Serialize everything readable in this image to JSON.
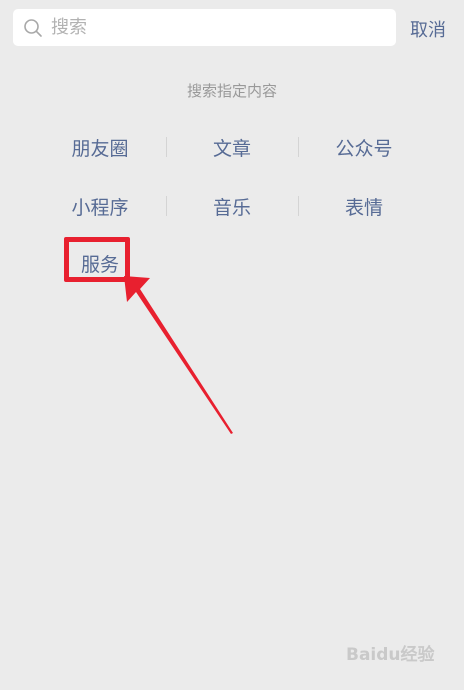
{
  "search": {
    "placeholder": "搜索",
    "cancel_label": "取消"
  },
  "hint": "搜索指定内容",
  "categories": [
    [
      "朋友圈",
      "文章",
      "公众号"
    ],
    [
      "小程序",
      "音乐",
      "表情"
    ],
    [
      "服务"
    ]
  ],
  "annotation": {
    "highlight_color": "#e8202f",
    "highlighted_item": "服务"
  },
  "watermark": "Baidu经验"
}
